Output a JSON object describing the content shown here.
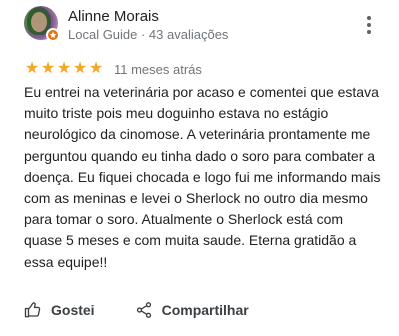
{
  "review": {
    "author_name": "Alinne Morais",
    "author_meta": "Local Guide · 43 avaliações",
    "more_icon": "more-vert-icon",
    "rating": 5,
    "rating_max": 5,
    "star_glyph": "★",
    "time": "11 meses atrás",
    "text": "Eu entrei na veterinária por acaso e comentei que estava muito triste pois meu doguinho estava no estágio neurológico da cinomose. A veterinária prontamente me perguntou quando eu tinha dado o soro para combater a doença. Eu fiquei chocada e logo fui me informando mais com as meninas e levei o Sherlock no outro dia mesmo para tomar o soro. Atualmente o Sherlock está com quase 5 meses e com muita saude. Eterna gratidão a essa equipe!!",
    "like_label": "Gostei",
    "share_label": "Compartilhar"
  },
  "colors": {
    "star": "#f5a623",
    "badge": "#e8710a",
    "meta_text": "#70757a",
    "primary_text": "#202124"
  }
}
